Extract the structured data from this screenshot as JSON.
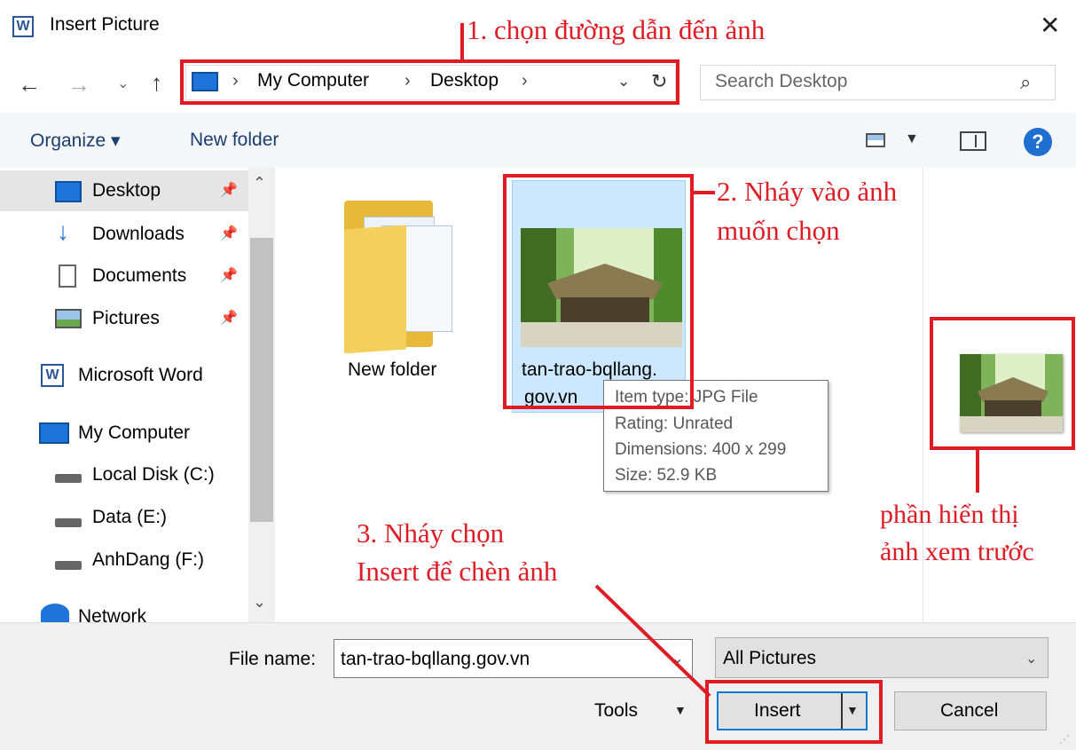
{
  "window": {
    "title": "Insert Picture",
    "app_icon_letter": "W",
    "close_glyph": "✕"
  },
  "nav": {
    "path": [
      "My Computer",
      "Desktop"
    ],
    "search_placeholder": "Search Desktop"
  },
  "toolbar": {
    "organize_label": "Organize ▾",
    "new_folder_label": "New folder",
    "help_glyph": "?"
  },
  "sidebar": {
    "items": [
      {
        "label": "Desktop",
        "icon": "desktop-icon",
        "pinned": true,
        "selected": true
      },
      {
        "label": "Downloads",
        "icon": "download-icon",
        "pinned": true
      },
      {
        "label": "Documents",
        "icon": "documents-icon",
        "pinned": true
      },
      {
        "label": "Pictures",
        "icon": "pictures-icon",
        "pinned": true
      },
      {
        "label": "Microsoft Word",
        "icon": "word-icon"
      },
      {
        "label": "My Computer",
        "icon": "computer-icon"
      },
      {
        "label": "Local Disk (C:)",
        "icon": "local-disk-icon"
      },
      {
        "label": "Data (E:)",
        "icon": "drive-icon"
      },
      {
        "label": "AnhDang (F:)",
        "icon": "drive-icon"
      },
      {
        "label": "Network",
        "icon": "network-icon"
      }
    ]
  },
  "content": {
    "items": [
      {
        "label": "New folder",
        "type": "folder"
      },
      {
        "label_line1": "tan-trao-bqllang.",
        "label_line2": "gov.vn",
        "type": "image",
        "selected": true
      }
    ],
    "tooltip": {
      "type": "Item type: JPG File",
      "rating": "Rating: Unrated",
      "dimensions": "Dimensions: 400 x 299",
      "size": "Size: 52.9 KB"
    }
  },
  "bottom": {
    "file_name_label": "File name:",
    "file_name_value": "tan-trao-bqllang.gov.vn",
    "filter_value": "All Pictures",
    "tools_label": "Tools",
    "insert_label": "Insert",
    "cancel_label": "Cancel"
  },
  "annotations": {
    "step1": "1. chọn đường dẫn đến ảnh",
    "step2_line1": "2. Nháy vào ảnh",
    "step2_line2": "muốn chọn",
    "step3_line1": "3. Nháy chọn",
    "step3_line2": "Insert để chèn ảnh",
    "preview_line1": "phần hiển thị",
    "preview_line2": "ảnh xem trước"
  },
  "colors": {
    "annotation": "#e01b24",
    "selection": "#cce8ff",
    "accent": "#0078d7"
  }
}
